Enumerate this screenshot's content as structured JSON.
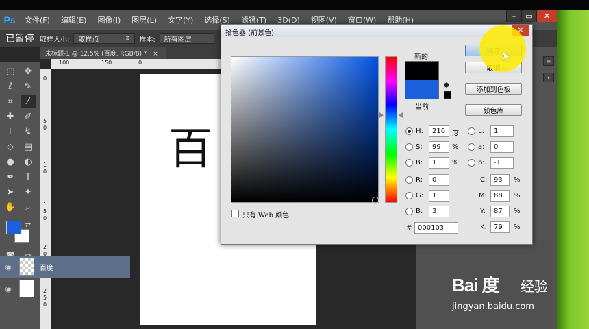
{
  "app": {
    "logo": "Ps"
  },
  "menu": [
    "文件(F)",
    "编辑(E)",
    "图像(I)",
    "图层(L)",
    "文字(Y)",
    "选择(S)",
    "滤镜(T)",
    "3D(D)",
    "视图(V)",
    "窗口(W)",
    "帮助(H)"
  ],
  "window_buttons": {
    "minimize": "–",
    "maximize": "▭",
    "close": "✕"
  },
  "options_bar": {
    "paused": "已暂停",
    "sample_size_label": "取样大小:",
    "sample_size_value": "取样点",
    "sample_label": "样本:",
    "sample_value": "所有图层"
  },
  "document_tab": {
    "title": "未标题-1 @ 12.5% (百度, RGB/8) *",
    "close": "×"
  },
  "rulers": {
    "horizontal": [
      "100",
      "150",
      "0"
    ],
    "vertical": [
      "0",
      "5",
      "0",
      "1",
      "0",
      "1",
      "5",
      "0",
      "2",
      "0",
      "0",
      "2",
      "5",
      "0"
    ]
  },
  "canvas": {
    "text": "百"
  },
  "layers": [
    {
      "name": "百度"
    },
    {
      "name": ""
    }
  ],
  "color_picker": {
    "title": "拾色器 (前景色)",
    "close": "✕",
    "new_label": "新的",
    "current_label": "当前",
    "new_color": "#000103",
    "current_color": "#1a5fdc",
    "buttons": {
      "ok": "确定",
      "cancel": "取消",
      "add_swatch": "添加到色板",
      "library": "颜色库"
    },
    "web_only_label": "只有 Web 颜色",
    "fields": {
      "H": {
        "label": "H:",
        "value": "216",
        "unit": "度",
        "selected": true
      },
      "S": {
        "label": "S:",
        "value": "99",
        "unit": "%"
      },
      "B": {
        "label": "B:",
        "value": "1",
        "unit": "%"
      },
      "R": {
        "label": "R:",
        "value": "0"
      },
      "G": {
        "label": "G:",
        "value": "1"
      },
      "Bb": {
        "label": "B:",
        "value": "3"
      },
      "L": {
        "label": "L:",
        "value": "1"
      },
      "a": {
        "label": "a:",
        "value": "0"
      },
      "b": {
        "label": "b:",
        "value": "-1"
      },
      "C": {
        "label": "C:",
        "value": "93",
        "unit": "%"
      },
      "M": {
        "label": "M:",
        "value": "88",
        "unit": "%"
      },
      "Y": {
        "label": "Y:",
        "value": "87",
        "unit": "%"
      },
      "K": {
        "label": "K:",
        "value": "79",
        "unit": "%"
      },
      "hex": {
        "label": "#",
        "value": "000103"
      }
    }
  },
  "watermark": {
    "logo": "Bai 度",
    "jingyan": "经验",
    "url": "jingyan.baidu.com"
  }
}
